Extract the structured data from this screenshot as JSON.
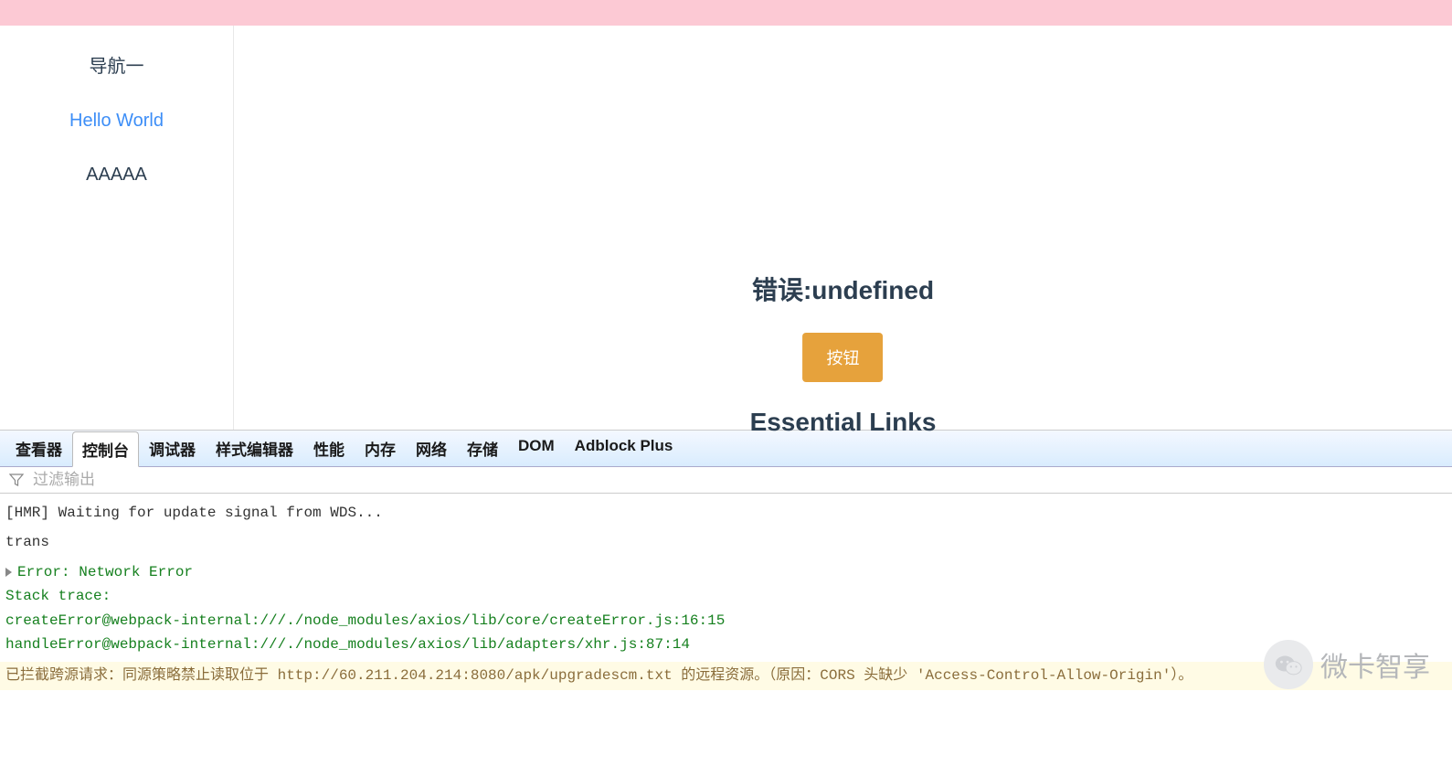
{
  "sidebar": {
    "items": [
      {
        "label": "导航一"
      },
      {
        "label": "Hello World"
      },
      {
        "label": "AAAAA"
      }
    ]
  },
  "main": {
    "error_label": "错误:undefined",
    "button_label": "按钮",
    "links_heading": "Essential Links"
  },
  "devtools": {
    "tabs": [
      "查看器",
      "控制台",
      "调试器",
      "样式编辑器",
      "性能",
      "内存",
      "网络",
      "存储",
      "DOM",
      "Adblock Plus"
    ],
    "active_tab_index": 1,
    "filter_placeholder": "过滤输出",
    "logs": {
      "hmr": "[HMR] Waiting for update signal from WDS...",
      "trans": "trans",
      "err_head": "Error: Network Error",
      "stack_label": "Stack trace:",
      "stack1": "createError@webpack-internal:///./node_modules/axios/lib/core/createError.js:16:15",
      "stack2": "handleError@webpack-internal:///./node_modules/axios/lib/adapters/xhr.js:87:14",
      "cors": "已拦截跨源请求：同源策略禁止读取位于 http://60.211.204.214:8080/apk/upgradescm.txt 的远程资源。（原因：CORS 头缺少 'Access-Control-Allow-Origin'）。"
    }
  },
  "watermark": "微卡智享"
}
